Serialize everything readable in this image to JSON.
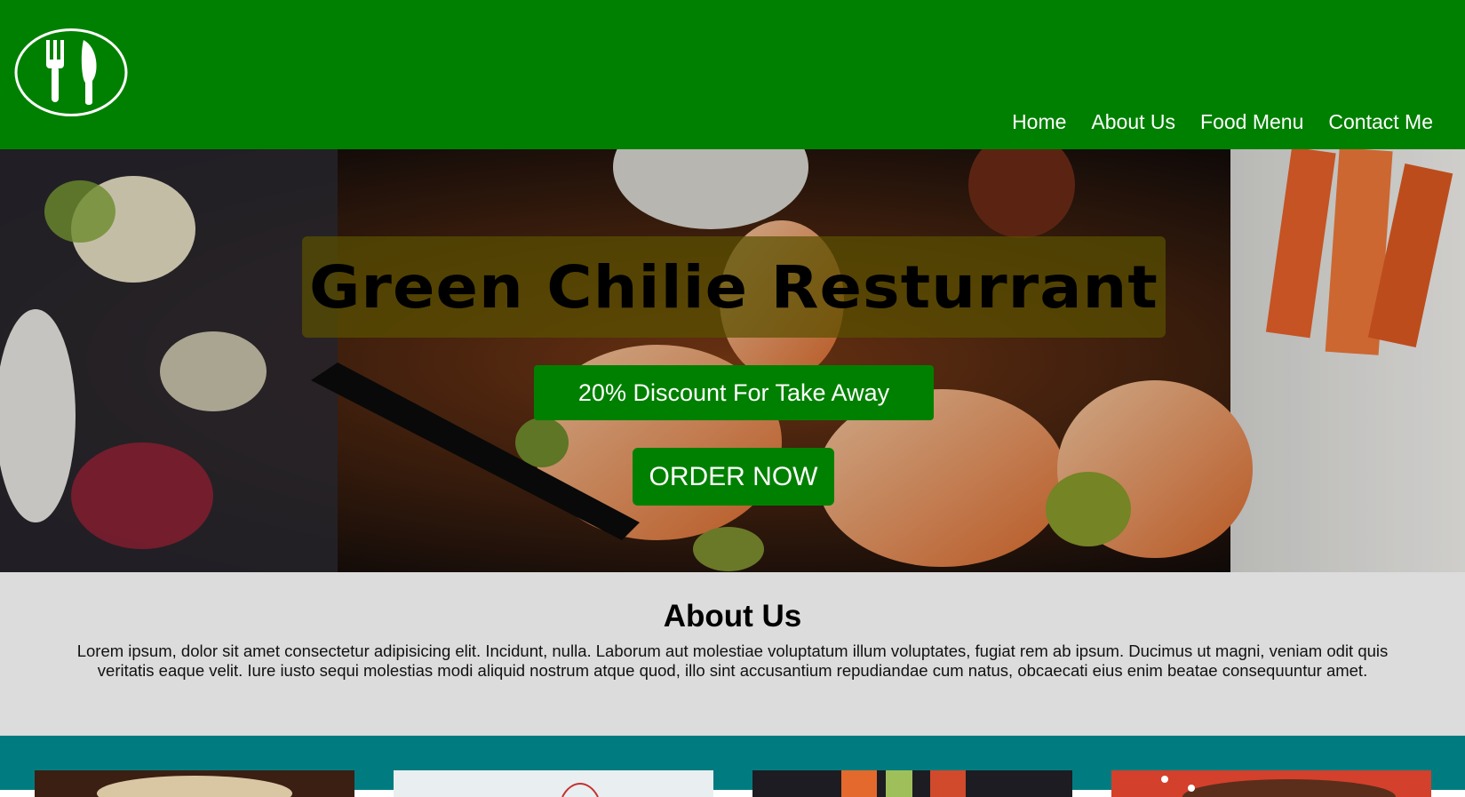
{
  "header": {
    "logo_icon": "fork-knife-icon",
    "nav": [
      "Home",
      "About Us",
      "Food Menu",
      "Contact Me"
    ]
  },
  "hero": {
    "title": "Green Chilie Resturrant",
    "discount": "20% Discount For Take Away",
    "order_button": "ORDER NOW"
  },
  "about": {
    "heading": "About Us",
    "body": "Lorem ipsum, dolor sit amet consectetur adipisicing elit. Incidunt, nulla. Laborum aut molestiae voluptatum illum voluptates, fugiat rem ab ipsum. Ducimus ut magni, veniam odit quis veritatis eaque velit. Iure iusto sequi molestias modi aliquid nostrum atque quod, illo sint accusantium repudiandae cum natus, obcaecati eius enim beatae consequuntur amet."
  },
  "colors": {
    "brand_green": "#008000",
    "about_bg": "#dcdcdc",
    "cards_bg": "#007c80"
  }
}
